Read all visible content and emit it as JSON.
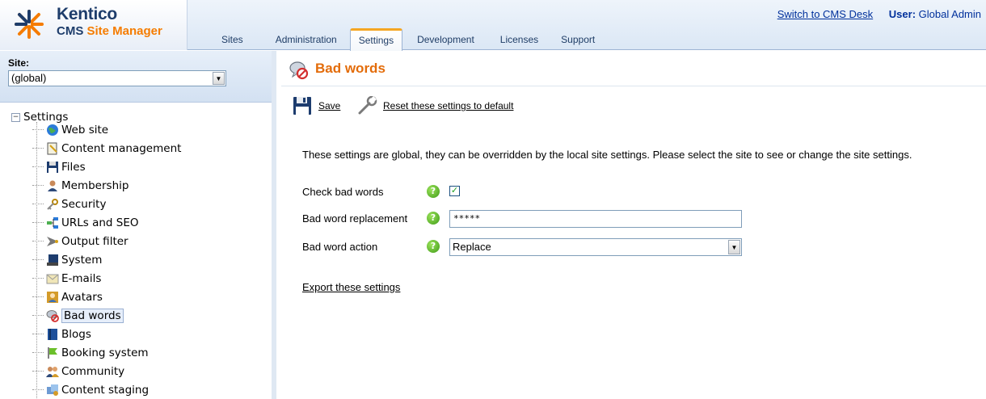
{
  "header": {
    "brand": "Kentico",
    "product_prefix": "CMS ",
    "product_accent": "Site Manager",
    "switch_link": "Switch to CMS Desk",
    "user_label": "User:",
    "user_name": "Global Admin",
    "tabs": [
      {
        "label": "Sites",
        "active": false
      },
      {
        "label": "Administration",
        "active": false
      },
      {
        "label": "Settings",
        "active": true
      },
      {
        "label": "Development",
        "active": false
      },
      {
        "label": "Licenses",
        "active": false
      },
      {
        "label": "Support",
        "active": false
      }
    ]
  },
  "site_selector": {
    "label": "Site:",
    "value": "(global)"
  },
  "tree": {
    "root": "Settings",
    "items": [
      {
        "label": "Web site",
        "icon": "globe-icon"
      },
      {
        "label": "Content management",
        "icon": "content-management-icon"
      },
      {
        "label": "Files",
        "icon": "floppy-icon"
      },
      {
        "label": "Membership",
        "icon": "user-icon"
      },
      {
        "label": "Security",
        "icon": "key-icon"
      },
      {
        "label": "URLs and SEO",
        "icon": "sitemap-icon"
      },
      {
        "label": "Output filter",
        "icon": "filter-icon"
      },
      {
        "label": "System",
        "icon": "computer-icon"
      },
      {
        "label": "E-mails",
        "icon": "envelope-icon"
      },
      {
        "label": "Avatars",
        "icon": "avatar-icon"
      },
      {
        "label": "Bad words",
        "icon": "bad-words-icon",
        "selected": true
      },
      {
        "label": "Blogs",
        "icon": "book-icon"
      },
      {
        "label": "Booking system",
        "icon": "flag-icon"
      },
      {
        "label": "Community",
        "icon": "group-icon"
      },
      {
        "label": "Content staging",
        "icon": "staging-icon"
      }
    ]
  },
  "main": {
    "title": "Bad words",
    "toolbar": {
      "save_label": "Save",
      "reset_label": "Reset these settings to default"
    },
    "info_text": "These settings are global, they can be overridden by the local site settings. Please select the site to see or change the site settings.",
    "fields": {
      "check_bad_words": {
        "label": "Check bad words",
        "checked": true
      },
      "replacement": {
        "label": "Bad word replacement",
        "value": "*****"
      },
      "action": {
        "label": "Bad word action",
        "value": "Replace"
      }
    },
    "export_link": "Export these settings"
  },
  "colors": {
    "title_orange": "#e36c0a",
    "tab_accent": "#f5a623",
    "link_blue": "#00309c",
    "help_green": "#3f9a18"
  }
}
